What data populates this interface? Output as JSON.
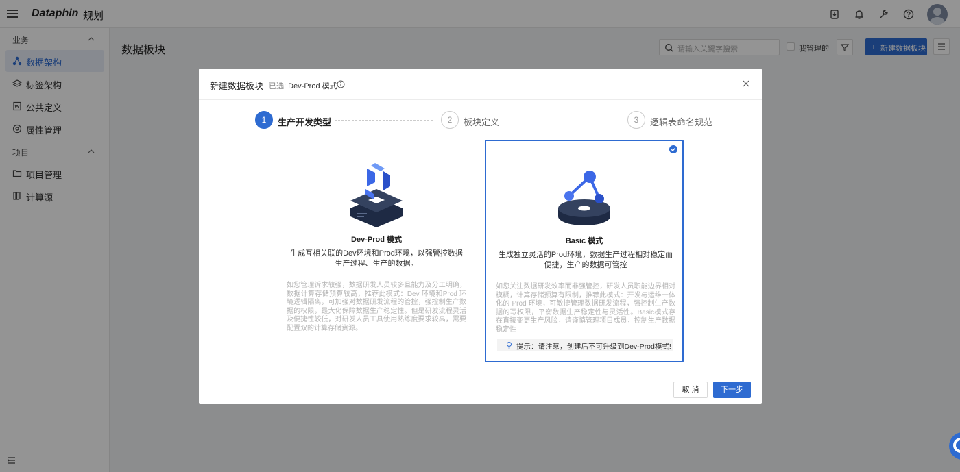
{
  "topbar": {
    "logo": "Dataphin",
    "module": "规划",
    "icons": [
      "menu-icon",
      "package-icon",
      "bell-icon",
      "wrench-icon",
      "help-icon",
      "user-avatar"
    ]
  },
  "sidebar": {
    "groups": [
      {
        "label": "业务",
        "items": [
          {
            "label": "数据架构",
            "icon": "architecture-icon",
            "active": true
          },
          {
            "label": "标签架构",
            "icon": "layers-icon"
          },
          {
            "label": "公共定义",
            "icon": "document-icon"
          },
          {
            "label": "属性管理",
            "icon": "settings-circle-icon"
          }
        ]
      },
      {
        "label": "项目",
        "items": [
          {
            "label": "项目管理",
            "icon": "folder-icon"
          },
          {
            "label": "计算源",
            "icon": "compute-icon"
          }
        ]
      }
    ]
  },
  "main": {
    "title": "数据板块",
    "search_placeholder": "请输入关键字搜索",
    "mine_label": "我管理的",
    "new_button": "新建数据板块"
  },
  "modal": {
    "title": "新建数据板块",
    "selected_prefix": "已选:",
    "selected_value": "Dev-Prod 模式",
    "steps": [
      {
        "num": "1",
        "label": "生产开发类型",
        "state": "active"
      },
      {
        "num": "2",
        "label": "板块定义",
        "state": "idle"
      },
      {
        "num": "3",
        "label": "逻辑表命名规范",
        "state": "idle"
      }
    ],
    "cards": [
      {
        "name": "Dev-Prod 模式",
        "desc": "生成互相关联的Dev环境和Prod环境，以强管控数据生产过程、生产的数据。",
        "detail": "如您管理诉求较强，数据研发人员较多且能力及分工明确，数据计算存储预算较高，推荐此模式：Dev 环境和Prod 环境逻辑隔离，可加强对数据研发流程的管控，强控制生产数据的权限，最大化保障数据生产稳定性。但是研发流程灵活及便捷性较低，对研发人员工具使用熟练度要求较高，需要配置双的计算存储资源。",
        "selected": false
      },
      {
        "name": "Basic 模式",
        "desc": "生成独立灵活的Prod环境，数据生产过程相对稳定而便捷，生产的数据可管控",
        "detail": "如您关注数据研发效率而非强管控，研发人员职能边界相对模糊，计算存储预算有限制，推荐此模式：开发与运维一体化的 Prod 环境，可敏捷管理数据研发流程，强控制生产数据的写权限，平衡数据生产稳定性与灵活性。Basic模式存在直接变更生产风险，请谨慎管理项目成员，控制生产数据稳定性",
        "tip": "提示：请注意，创建后不可升级到Dev-Prod模式!",
        "selected": true
      }
    ],
    "cancel": "取 消",
    "next": "下一步"
  },
  "colors": {
    "primary": "#2e6bd1",
    "mask": "rgba(0,0,0,0.42)"
  }
}
